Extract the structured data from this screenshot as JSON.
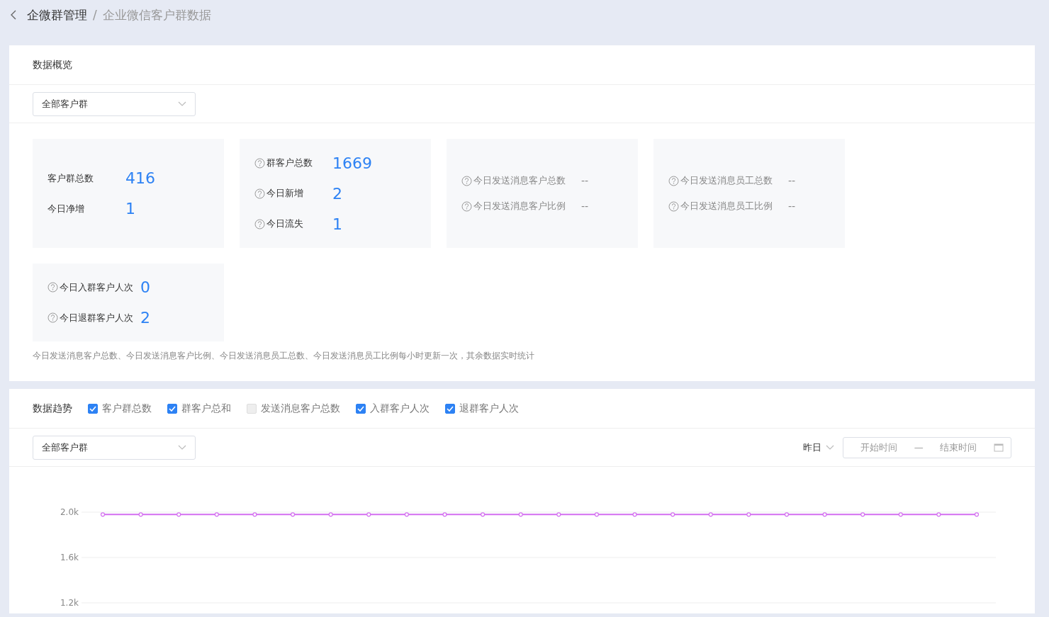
{
  "breadcrumb": {
    "parent": "企微群管理",
    "separator": "/",
    "current": "企业微信客户群数据"
  },
  "overview": {
    "title": "数据概览",
    "group_select": {
      "value": "全部客户群"
    },
    "stat_groups": [
      {
        "disabled": false,
        "items": [
          {
            "label": "客户群总数",
            "help": false,
            "value": "416"
          },
          {
            "label": "今日净增",
            "help": false,
            "value": "1"
          }
        ]
      },
      {
        "disabled": false,
        "items": [
          {
            "label": "群客户总数",
            "help": true,
            "value": "1669"
          },
          {
            "label": "今日新增",
            "help": true,
            "value": "2"
          },
          {
            "label": "今日流失",
            "help": true,
            "value": "1"
          }
        ]
      },
      {
        "disabled": true,
        "items": [
          {
            "label": "今日发送消息客户总数",
            "help": true,
            "value": "--"
          },
          {
            "label": "今日发送消息客户比例",
            "help": true,
            "value": "--"
          }
        ]
      },
      {
        "disabled": true,
        "items": [
          {
            "label": "今日发送消息员工总数",
            "help": true,
            "value": "--"
          },
          {
            "label": "今日发送消息员工比例",
            "help": true,
            "value": "--"
          }
        ]
      },
      {
        "disabled": false,
        "items": [
          {
            "label": "今日入群客户人次",
            "help": true,
            "value": "0"
          },
          {
            "label": "今日退群客户人次",
            "help": true,
            "value": "2"
          }
        ]
      }
    ],
    "note": "今日发送消息客户总数、今日发送消息客户比例、今日发送消息员工总数、今日发送消息员工比例每小时更新一次，其余数据实时统计"
  },
  "trend": {
    "title": "数据趋势",
    "metrics": [
      {
        "label": "客户群总数",
        "checked": true,
        "disabled": false
      },
      {
        "label": "群客户总和",
        "checked": true,
        "disabled": false
      },
      {
        "label": "发送消息客户总数",
        "checked": false,
        "disabled": true
      },
      {
        "label": "入群客户人次",
        "checked": true,
        "disabled": false
      },
      {
        "label": "退群客户人次",
        "checked": true,
        "disabled": false
      }
    ],
    "group_select": {
      "value": "全部客户群"
    },
    "period": "昨日",
    "date_range": {
      "start_placeholder": "开始时间",
      "separator": "—",
      "end_placeholder": "结束时间"
    },
    "chart_data": {
      "type": "line",
      "grid": true,
      "ylim": [
        1200,
        2000
      ],
      "yticks": [
        {
          "value": 1200,
          "label": "1.2k"
        },
        {
          "value": 1600,
          "label": "1.6k"
        },
        {
          "value": 2000,
          "label": "2.0k"
        }
      ],
      "series": [
        {
          "color": "#d36ef0",
          "marker": "circle",
          "values": [
            1979,
            1979,
            1979,
            1979,
            1979,
            1979,
            1979,
            1979,
            1979,
            1979,
            1979,
            1979,
            1979,
            1979,
            1979,
            1979,
            1979,
            1979,
            1979,
            1979,
            1979,
            1979,
            1979,
            1979
          ]
        }
      ]
    }
  }
}
